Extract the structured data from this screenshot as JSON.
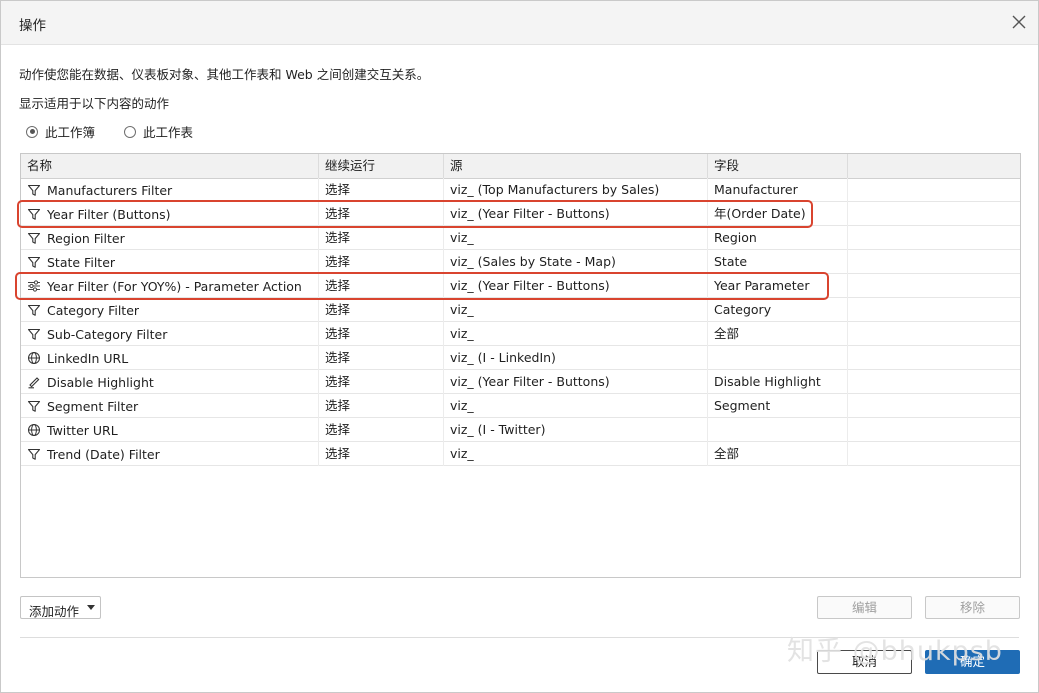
{
  "dialog": {
    "title": "操作",
    "description": "动作使您能在数据、仪表板对象、其他工作表和 Web 之间创建交互关系。",
    "show_label": "显示适用于以下内容的动作",
    "scope_options": [
      {
        "label": "此工作簿",
        "selected": true
      },
      {
        "label": "此工作表",
        "selected": false
      }
    ]
  },
  "table": {
    "columns": [
      "名称",
      "继续运行",
      "源",
      "字段",
      ""
    ],
    "rows": [
      {
        "icon": "filter-icon",
        "name": "Manufacturers Filter",
        "run_on": "选择",
        "source": "viz_ (Top Manufacturers by Sales)",
        "field": "Manufacturer",
        "highlighted": false
      },
      {
        "icon": "filter-icon",
        "name": "Year Filter (Buttons)",
        "run_on": "选择",
        "source": "viz_ (Year Filter - Buttons)",
        "field": "年(Order Date)",
        "highlighted": true
      },
      {
        "icon": "filter-icon",
        "name": "Region Filter",
        "run_on": "选择",
        "source": "viz_",
        "field": "Region",
        "highlighted": false
      },
      {
        "icon": "filter-icon",
        "name": "State Filter",
        "run_on": "选择",
        "source": "viz_ (Sales by State - Map)",
        "field": "State",
        "highlighted": false
      },
      {
        "icon": "parameter-icon",
        "name": "Year Filter (For YOY%) - Parameter Action",
        "run_on": "选择",
        "source": "viz_ (Year Filter - Buttons)",
        "field": "Year Parameter",
        "highlighted": true
      },
      {
        "icon": "filter-icon",
        "name": "Category Filter",
        "run_on": "选择",
        "source": "viz_",
        "field": "Category",
        "highlighted": false
      },
      {
        "icon": "filter-icon",
        "name": "Sub-Category Filter",
        "run_on": "选择",
        "source": "viz_",
        "field": "全部",
        "highlighted": false
      },
      {
        "icon": "globe-icon",
        "name": "LinkedIn URL",
        "run_on": "选择",
        "source": "viz_ (I - LinkedIn)",
        "field": "",
        "highlighted": false
      },
      {
        "icon": "highlight-pen-icon",
        "name": "Disable Highlight",
        "run_on": "选择",
        "source": "viz_ (Year Filter - Buttons)",
        "field": "Disable Highlight",
        "highlighted": false
      },
      {
        "icon": "filter-icon",
        "name": "Segment Filter",
        "run_on": "选择",
        "source": "viz_",
        "field": "Segment",
        "highlighted": false
      },
      {
        "icon": "globe-icon",
        "name": "Twitter URL",
        "run_on": "选择",
        "source": "viz_ (I - Twitter)",
        "field": "",
        "highlighted": false
      },
      {
        "icon": "filter-icon",
        "name": "Trend (Date) Filter",
        "run_on": "选择",
        "source": "viz_",
        "field": "全部",
        "highlighted": false
      }
    ]
  },
  "buttons": {
    "add_action": "添加动作",
    "edit": "编辑",
    "remove": "移除",
    "cancel": "取消",
    "ok": "确定"
  },
  "watermark": "知乎 @bhukpsb",
  "colors": {
    "highlight_border": "#d9442f",
    "primary_button": "#1f6cb5",
    "header_bg": "#f1f1f1"
  }
}
